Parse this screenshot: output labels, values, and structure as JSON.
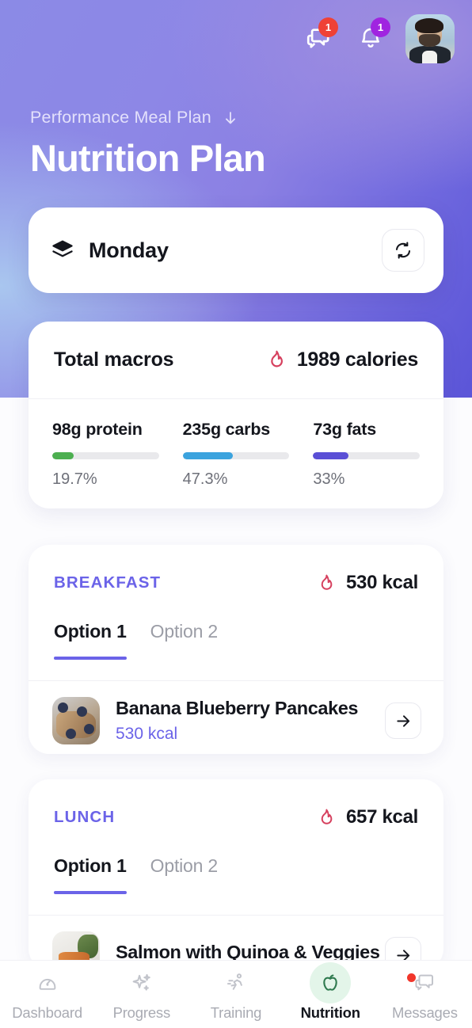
{
  "header": {
    "subtitle": "Performance Meal Plan",
    "subtitle_icon": "arrow-down-icon",
    "title": "Nutrition Plan",
    "messages_badge": "1",
    "notifications_badge": "1",
    "messages_icon": "chat-bubbles-icon",
    "notifications_icon": "bell-icon",
    "avatar": "user-avatar"
  },
  "day_selector": {
    "icon": "layers-icon",
    "label": "Monday",
    "refresh_icon": "refresh-icon"
  },
  "macros": {
    "title": "Total macros",
    "calories": "1989 calories",
    "calories_icon": "flame-icon",
    "items": [
      {
        "label": "98g protein",
        "percent": "19.7%",
        "fill": 19.7,
        "color": "#4CAF50"
      },
      {
        "label": "235g carbs",
        "percent": "47.3%",
        "fill": 47.3,
        "color": "#3BA3DE"
      },
      {
        "label": "73g fats",
        "percent": "33%",
        "fill": 33.0,
        "color": "#5A4FD6"
      }
    ]
  },
  "meals": [
    {
      "kind": "BREAKFAST",
      "kcal": "530 kcal",
      "kcal_icon": "flame-icon",
      "tabs": [
        {
          "label": "Option 1",
          "active": true
        },
        {
          "label": "Option 2",
          "active": false
        }
      ],
      "item": {
        "name": "Banana Blueberry Pancakes",
        "kcal": "530 kcal",
        "thumb": "pancakes-photo",
        "go_icon": "arrow-right-icon"
      }
    },
    {
      "kind": "LUNCH",
      "kcal": "657 kcal",
      "kcal_icon": "flame-icon",
      "tabs": [
        {
          "label": "Option 1",
          "active": true
        },
        {
          "label": "Option 2",
          "active": false
        }
      ],
      "item": {
        "name": "Salmon with Quinoa & Veggies",
        "kcal": "",
        "thumb": "salmon-photo",
        "go_icon": "arrow-right-icon"
      }
    }
  ],
  "bottom_nav": {
    "items": [
      {
        "label": "Dashboard",
        "icon": "gauge-icon",
        "active": false,
        "dot": false
      },
      {
        "label": "Progress",
        "icon": "sparkles-icon",
        "active": false,
        "dot": false
      },
      {
        "label": "Training",
        "icon": "running-icon",
        "active": false,
        "dot": false
      },
      {
        "label": "Nutrition",
        "icon": "apple-icon",
        "active": true,
        "dot": false
      },
      {
        "label": "Messages",
        "icon": "chat-bubbles-icon",
        "active": false,
        "dot": true
      }
    ]
  },
  "colors": {
    "accent": "#6b63e8",
    "flame": "#d6405e",
    "protein": "#4CAF50",
    "carbs": "#3BA3DE",
    "fats": "#5A4FD6",
    "badge_red": "#ef4136",
    "badge_purple": "#a024e0",
    "nutrition_green": "#2f7a4f"
  }
}
